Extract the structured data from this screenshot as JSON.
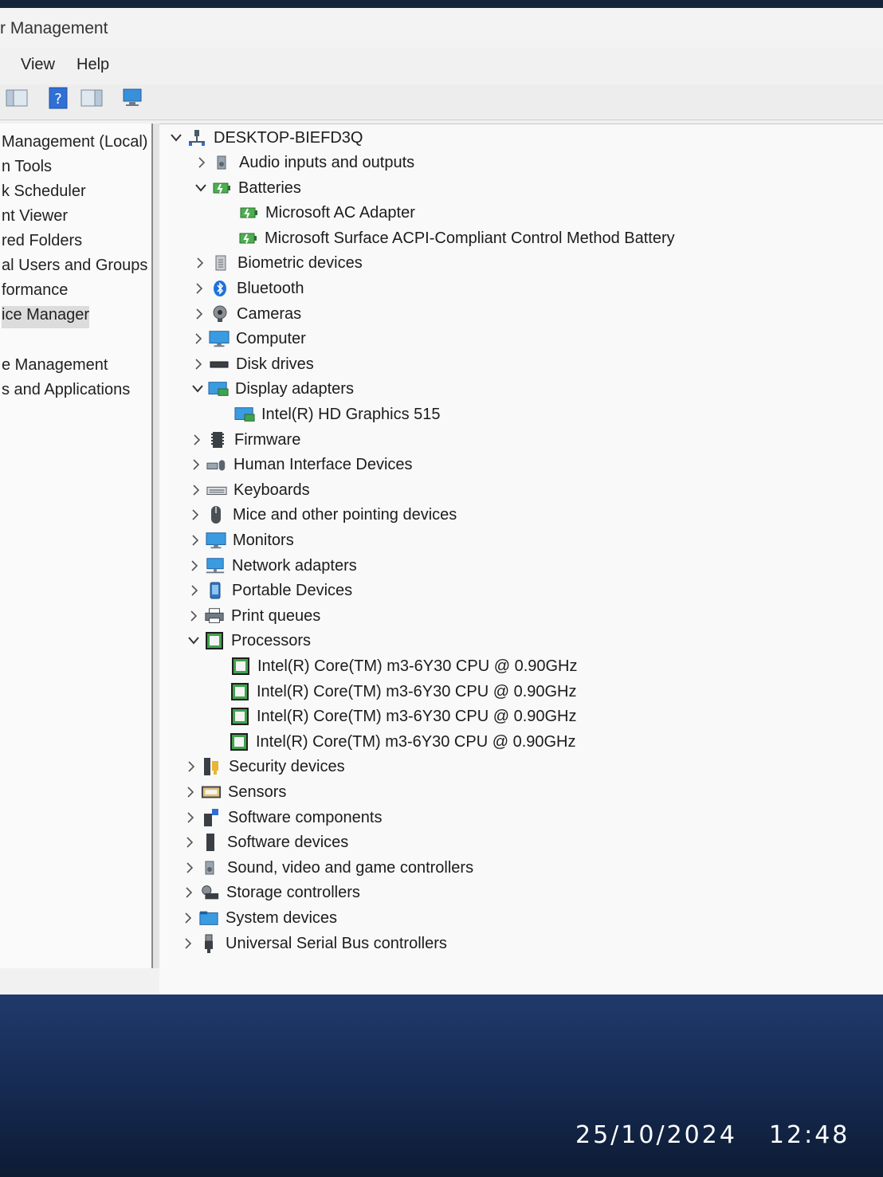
{
  "window": {
    "title": "r Management",
    "menu": [
      "View",
      "Help"
    ]
  },
  "left_pane": {
    "items": [
      {
        "label": "Management (Local)",
        "selected": false
      },
      {
        "label": "n Tools",
        "selected": false
      },
      {
        "label": "k Scheduler",
        "selected": false
      },
      {
        "label": "nt Viewer",
        "selected": false
      },
      {
        "label": "red Folders",
        "selected": false
      },
      {
        "label": "al Users and Groups",
        "selected": false
      },
      {
        "label": "formance",
        "selected": false
      },
      {
        "label": "ice Manager",
        "selected": true
      },
      {
        "label": "e Management",
        "selected": false
      },
      {
        "label": "s and Applications",
        "selected": false
      }
    ]
  },
  "device_tree": {
    "root": {
      "label": "DESKTOP-BIEFD3Q",
      "icon": "computer-network-icon"
    },
    "rows": [
      {
        "label": "Audio inputs and outputs",
        "level": 1,
        "state": "collapsed",
        "icon": "speaker-icon"
      },
      {
        "label": "Batteries",
        "level": 1,
        "state": "expanded",
        "icon": "battery-icon"
      },
      {
        "label": "Microsoft AC Adapter",
        "level": 2,
        "state": "none",
        "icon": "battery-icon"
      },
      {
        "label": "Microsoft Surface ACPI-Compliant Control Method Battery",
        "level": 2,
        "state": "none",
        "icon": "battery-icon"
      },
      {
        "label": "Biometric devices",
        "level": 1,
        "state": "collapsed",
        "icon": "fingerprint-icon"
      },
      {
        "label": "Bluetooth",
        "level": 1,
        "state": "collapsed",
        "icon": "bluetooth-icon"
      },
      {
        "label": "Cameras",
        "level": 1,
        "state": "collapsed",
        "icon": "camera-icon"
      },
      {
        "label": "Computer",
        "level": 1,
        "state": "collapsed",
        "icon": "monitor-icon"
      },
      {
        "label": "Disk drives",
        "level": 1,
        "state": "collapsed",
        "icon": "disk-drive-icon"
      },
      {
        "label": "Display adapters",
        "level": 1,
        "state": "expanded",
        "icon": "display-adapter-icon"
      },
      {
        "label": "Intel(R) HD Graphics 515",
        "level": 2,
        "state": "none",
        "icon": "display-adapter-icon"
      },
      {
        "label": "Firmware",
        "level": 1,
        "state": "collapsed",
        "icon": "firmware-icon"
      },
      {
        "label": "Human Interface Devices",
        "level": 1,
        "state": "collapsed",
        "icon": "hid-icon"
      },
      {
        "label": "Keyboards",
        "level": 1,
        "state": "collapsed",
        "icon": "keyboard-icon"
      },
      {
        "label": "Mice and other pointing devices",
        "level": 1,
        "state": "collapsed",
        "icon": "mouse-icon"
      },
      {
        "label": "Monitors",
        "level": 1,
        "state": "collapsed",
        "icon": "monitor-icon"
      },
      {
        "label": "Network adapters",
        "level": 1,
        "state": "collapsed",
        "icon": "network-adapter-icon"
      },
      {
        "label": "Portable Devices",
        "level": 1,
        "state": "collapsed",
        "icon": "portable-device-icon"
      },
      {
        "label": "Print queues",
        "level": 1,
        "state": "collapsed",
        "icon": "printer-icon"
      },
      {
        "label": "Processors",
        "level": 1,
        "state": "expanded",
        "icon": "processor-icon"
      },
      {
        "label": "Intel(R) Core(TM) m3-6Y30 CPU @ 0.90GHz",
        "level": 2,
        "state": "none",
        "icon": "processor-icon"
      },
      {
        "label": "Intel(R) Core(TM) m3-6Y30 CPU @ 0.90GHz",
        "level": 2,
        "state": "none",
        "icon": "processor-icon"
      },
      {
        "label": "Intel(R) Core(TM) m3-6Y30 CPU @ 0.90GHz",
        "level": 2,
        "state": "none",
        "icon": "processor-icon"
      },
      {
        "label": "Intel(R) Core(TM) m3-6Y30 CPU @ 0.90GHz",
        "level": 2,
        "state": "none",
        "icon": "processor-icon"
      },
      {
        "label": "Security devices",
        "level": 1,
        "state": "collapsed",
        "icon": "security-key-icon"
      },
      {
        "label": "Sensors",
        "level": 1,
        "state": "collapsed",
        "icon": "sensor-icon"
      },
      {
        "label": "Software components",
        "level": 1,
        "state": "collapsed",
        "icon": "software-component-icon"
      },
      {
        "label": "Software devices",
        "level": 1,
        "state": "collapsed",
        "icon": "software-device-icon"
      },
      {
        "label": "Sound, video and game controllers",
        "level": 1,
        "state": "collapsed",
        "icon": "speaker-icon"
      },
      {
        "label": "Storage controllers",
        "level": 1,
        "state": "collapsed",
        "icon": "storage-controller-icon"
      },
      {
        "label": "System devices",
        "level": 1,
        "state": "collapsed",
        "icon": "system-folder-icon"
      },
      {
        "label": "Universal Serial Bus controllers",
        "level": 1,
        "state": "collapsed",
        "icon": "usb-icon"
      }
    ]
  },
  "timestamp": {
    "date": "25/10/2024",
    "time": "12:48"
  }
}
